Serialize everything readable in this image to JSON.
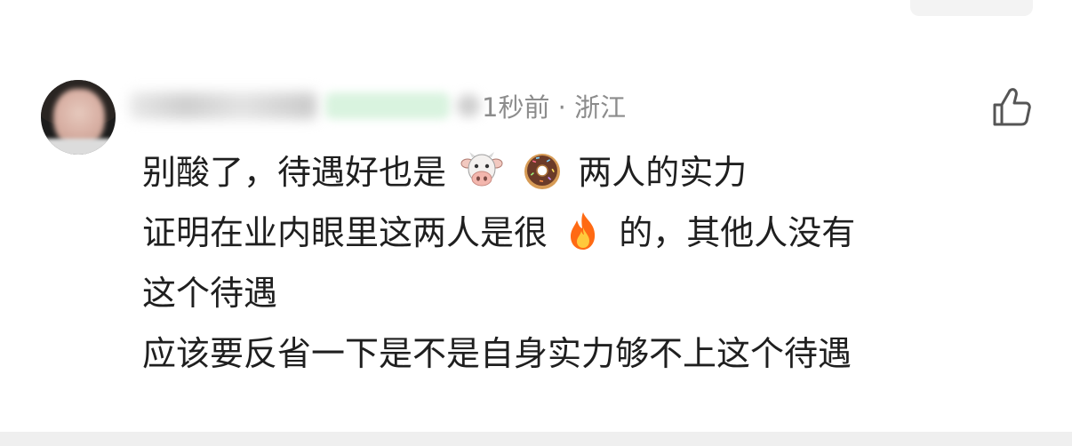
{
  "comment": {
    "time_location": "1秒前 · 浙江",
    "username": "",
    "badge": "",
    "lines": {
      "l1_a": "别酸了，待遇好也是",
      "l1_b": "两人的实力",
      "l2_a": "证明在业内眼里这两人是很",
      "l2_b": "的，其他人没有",
      "l3": "这个待遇",
      "l4": "应该要反省一下是不是自身实力够不上这个待遇"
    },
    "emojis": [
      "cow-face-icon",
      "doughnut-icon",
      "fire-icon"
    ]
  },
  "actions": {
    "like_icon": "thumbs-up-icon"
  },
  "colors": {
    "text": "#1f1f1f",
    "meta": "#8c8c8c",
    "background": "#ffffff"
  }
}
